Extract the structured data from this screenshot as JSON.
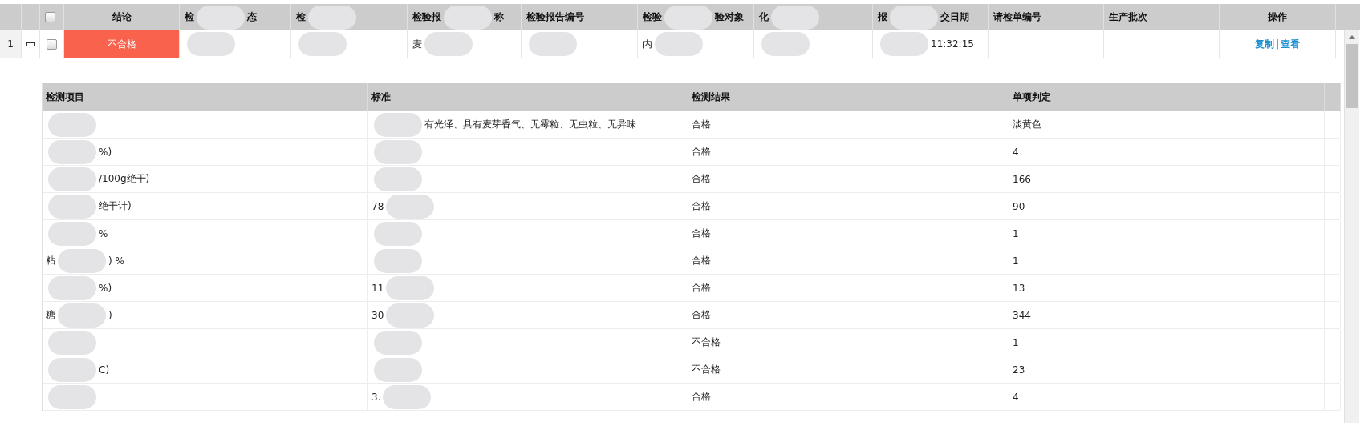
{
  "grid": {
    "columns": [
      {
        "kind": "index"
      },
      {
        "kind": "expander"
      },
      {
        "kind": "checkbox",
        "checked": false
      },
      {
        "centered": true,
        "segments": [
          {
            "text": "结论"
          }
        ]
      },
      {
        "segments": [
          {
            "text": "检"
          },
          {
            "kind": "blur"
          },
          {
            "text": "态"
          }
        ]
      },
      {
        "segments": [
          {
            "text": "检"
          },
          {
            "kind": "blur"
          }
        ]
      },
      {
        "segments": [
          {
            "text": "检验报"
          },
          {
            "kind": "blur"
          },
          {
            "text": "称"
          }
        ]
      },
      {
        "segments": [
          {
            "text": "检验报告编号"
          }
        ]
      },
      {
        "segments": [
          {
            "text": "检验"
          },
          {
            "kind": "blur"
          },
          {
            "text": "验对象"
          }
        ]
      },
      {
        "segments": [
          {
            "text": "化"
          },
          {
            "kind": "blur"
          }
        ]
      },
      {
        "segments": [
          {
            "text": "报"
          },
          {
            "kind": "blur"
          },
          {
            "text": "交日期"
          }
        ]
      },
      {
        "segments": [
          {
            "text": "请检单编号"
          }
        ]
      },
      {
        "segments": [
          {
            "text": "生产批次"
          }
        ]
      },
      {
        "centered": true,
        "segments": [
          {
            "text": "操作"
          }
        ]
      }
    ],
    "rows": [
      {
        "cells": [
          {
            "kind": "index",
            "text": "1"
          },
          {
            "kind": "expander",
            "expanded": true
          },
          {
            "kind": "checkbox",
            "checked": false
          },
          {
            "kind": "status",
            "text": "不合格",
            "passed": false
          },
          {
            "segments": [
              {
                "kind": "blur"
              }
            ]
          },
          {
            "segments": [
              {
                "kind": "blur"
              }
            ]
          },
          {
            "segments": [
              {
                "text": "麦"
              },
              {
                "kind": "blur"
              }
            ]
          },
          {
            "segments": [
              {
                "kind": "blur"
              }
            ]
          },
          {
            "segments": [
              {
                "text": "内"
              },
              {
                "kind": "blur"
              }
            ]
          },
          {
            "segments": [
              {
                "kind": "blur"
              }
            ]
          },
          {
            "segments": [
              {
                "kind": "blur"
              },
              {
                "text": "11:32:15"
              }
            ]
          },
          {},
          {},
          {
            "kind": "actions",
            "actions": [
              {
                "label": "复制"
              },
              {
                "label": "查看"
              }
            ],
            "separator": "|"
          }
        ],
        "detail": {
          "columns": [
            "检测项目",
            "标准",
            "检测结果",
            "单项判定"
          ],
          "rows": [
            {
              "item": [
                {
                  "kind": "blur"
                }
              ],
              "standard": [
                {
                  "kind": "blur"
                },
                {
                  "text": "有光泽、具有麦芽香气、无霉粒、无虫粒、无异味"
                }
              ],
              "result": "合格",
              "judgement": "淡黄色"
            },
            {
              "item": [
                {
                  "kind": "blur"
                },
                {
                  "text": "%)"
                }
              ],
              "standard": [
                {
                  "kind": "blur"
                }
              ],
              "result": "合格",
              "judgement": "4"
            },
            {
              "item": [
                {
                  "kind": "blur"
                },
                {
                  "text": "/100g绝干)"
                }
              ],
              "standard": [
                {
                  "kind": "blur"
                }
              ],
              "result": "合格",
              "judgement": "166"
            },
            {
              "item": [
                {
                  "kind": "blur"
                },
                {
                  "text": "绝干计)"
                }
              ],
              "standard": [
                {
                  "text": "78"
                },
                {
                  "kind": "blur"
                }
              ],
              "result": "合格",
              "judgement": "90"
            },
            {
              "item": [
                {
                  "kind": "blur"
                },
                {
                  "text": "%"
                }
              ],
              "standard": [
                {
                  "kind": "blur"
                }
              ],
              "result": "合格",
              "judgement": "1"
            },
            {
              "item": [
                {
                  "text": "粘"
                },
                {
                  "kind": "blur"
                },
                {
                  "text": ") %"
                }
              ],
              "standard": [
                {
                  "kind": "blur"
                }
              ],
              "result": "合格",
              "judgement": "1"
            },
            {
              "item": [
                {
                  "kind": "blur"
                },
                {
                  "text": "%)"
                }
              ],
              "standard": [
                {
                  "text": "11"
                },
                {
                  "kind": "blur"
                }
              ],
              "result": "合格",
              "judgement": "13"
            },
            {
              "item": [
                {
                  "text": "糖"
                },
                {
                  "kind": "blur"
                },
                {
                  "text": ")"
                }
              ],
              "standard": [
                {
                  "text": "30"
                },
                {
                  "kind": "blur"
                }
              ],
              "result": "合格",
              "judgement": "344"
            },
            {
              "item": [
                {
                  "kind": "blur"
                }
              ],
              "standard": [
                {
                  "kind": "blur"
                }
              ],
              "result": "不合格",
              "judgement": "1"
            },
            {
              "item": [
                {
                  "kind": "blur"
                },
                {
                  "text": "C)"
                }
              ],
              "standard": [
                {
                  "kind": "blur"
                }
              ],
              "result": "不合格",
              "judgement": "23"
            },
            {
              "item": [
                {
                  "kind": "blur"
                }
              ],
              "standard": [
                {
                  "text": "3."
                },
                {
                  "kind": "blur"
                }
              ],
              "result": "合格",
              "judgement": "4"
            }
          ]
        }
      }
    ]
  }
}
